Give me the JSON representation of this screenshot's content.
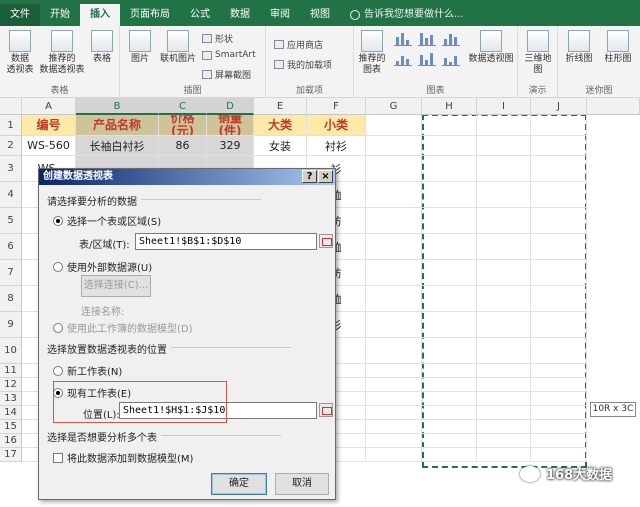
{
  "ribbon": {
    "tabs": [
      "文件",
      "开始",
      "插入",
      "页面布局",
      "公式",
      "数据",
      "审阅",
      "视图"
    ],
    "active_tab": "插入",
    "tell_me": "告诉我您想要做什么...",
    "groups": {
      "tables": {
        "label": "表格",
        "pivot": "数据\n透视表",
        "recommended_pivot": "推荐的\n数据透视表",
        "table": "表格"
      },
      "illustrations": {
        "label": "插图",
        "picture": "图片",
        "online_picture": "联机图片",
        "shapes": "形状",
        "smartart": "SmartArt",
        "screenshot": "屏幕截图"
      },
      "addins": {
        "label": "加载项",
        "store": "应用商店",
        "my_addins": "我的加载项"
      },
      "charts": {
        "label": "图表",
        "recommended": "推荐的\n图表",
        "pivot_chart": "数据透视图"
      },
      "tours": {
        "label": "演示",
        "map3d": "三维地\n图"
      },
      "sparklines": {
        "label": "迷你图",
        "line": "折线图",
        "column": "柱形图"
      }
    }
  },
  "sheet": {
    "columns": [
      "A",
      "B",
      "C",
      "D",
      "E",
      "F",
      "G",
      "H",
      "I",
      "J"
    ],
    "rows": [
      "1",
      "2",
      "3",
      "4",
      "5",
      "6",
      "7",
      "8",
      "9",
      "10",
      "11",
      "12",
      "13",
      "14",
      "15",
      "16",
      "17"
    ],
    "headers": [
      "编号",
      "产品名称",
      "价格\n(元)",
      "销量\n(件)",
      "大类",
      "小类"
    ],
    "row2": [
      "WS-560",
      "长袖白衬衫",
      "86",
      "329",
      "女装",
      "衬衫"
    ],
    "partial_a": [
      "WS-",
      "NS",
      "NS",
      "WS-",
      "WS-",
      "WS-",
      "WS-",
      "WS-"
    ],
    "partial_f": [
      "衫",
      "恤",
      "纺",
      "恤",
      "纺",
      "恤",
      "衫"
    ],
    "size_tip": "10R x 3C"
  },
  "dialog": {
    "title": "创建数据透视表",
    "help": "?",
    "close": "×",
    "section_data": "请选择要分析的数据",
    "opt_select_table": "选择一个表或区域(S)",
    "table_range_label": "表/区域(T):",
    "table_range_value": "Sheet1!$B$1:$D$10",
    "opt_external": "使用外部数据源(U)",
    "choose_connection": "选择连接(C)...",
    "connection_name": "连接名称:",
    "opt_data_model": "使用此工作簿的数据模型(D)",
    "section_location": "选择放置数据透视表的位置",
    "opt_new_sheet": "新工作表(N)",
    "opt_existing_sheet": "现有工作表(E)",
    "location_label": "位置(L):",
    "location_value": "Sheet1!$H$1:$J$10",
    "section_multi": "选择是否想要分析多个表",
    "add_to_model": "将此数据添加到数据模型(M)",
    "ok": "确定",
    "cancel": "取消"
  },
  "watermark": "168大数据",
  "colors": {
    "excel_green": "#217346",
    "header_fill": "#fde9a8",
    "header_text": "#c0392b",
    "highlight": "#d9534f"
  }
}
